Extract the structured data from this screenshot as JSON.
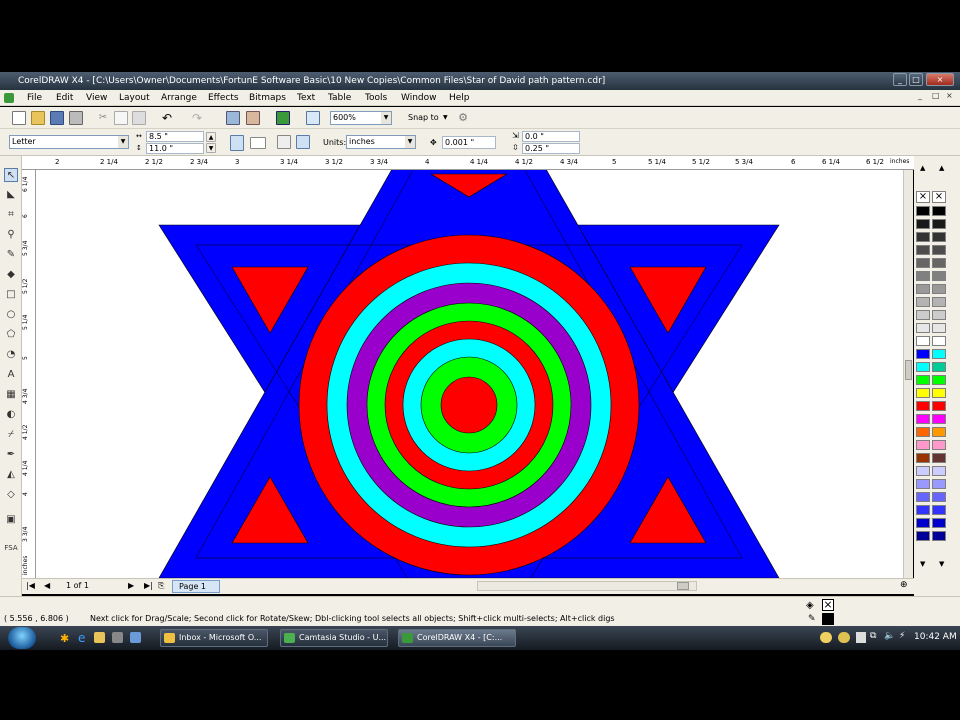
{
  "window": {
    "title": "CorelDRAW X4 - [C:\\Users\\Owner\\Documents\\FortunE Software Basic\\10 New Copies\\Common Files\\Star of David path pattern.cdr]",
    "min": "_",
    "max": "□",
    "close": "×"
  },
  "menu": [
    "File",
    "Edit",
    "View",
    "Layout",
    "Arrange",
    "Effects",
    "Bitmaps",
    "Text",
    "Table",
    "Tools",
    "Window",
    "Help"
  ],
  "toolbar": {
    "zoom": "600%",
    "snap_to": "Snap to"
  },
  "property_bar": {
    "paper": "Letter",
    "width": "8.5 \"",
    "height": "11.0 \"",
    "units_label": "Units:",
    "units": "inches",
    "nudge": "0.001 \"",
    "dup_x": "0.0 \"",
    "dup_y": "0.25 \""
  },
  "ruler_h": {
    "unit": "inches",
    "labels": [
      "2",
      "2 1/4",
      "2 1/2",
      "2 3/4",
      "3",
      "3 1/4",
      "3 1/2",
      "3 3/4",
      "4",
      "4 1/4",
      "4 1/2",
      "4 3/4",
      "5",
      "5 1/4",
      "5 1/2",
      "5 3/4",
      "6",
      "6 1/4",
      "6 1/2"
    ]
  },
  "ruler_v": {
    "unit": "inches",
    "labels": [
      "6 1/4",
      "6",
      "5 3/4",
      "5 1/2",
      "5 1/4",
      "5",
      "4 3/4",
      "4 1/2",
      "4 1/4",
      "4",
      "3 3/4"
    ]
  },
  "page_nav": {
    "count": "1 of 1",
    "tab": "Page 1"
  },
  "status": {
    "coords": "( 5.556 , 6.806 )",
    "hint": "Next click for Drag/Scale; Second click for Rotate/Skew; Dbl-clicking tool selects all objects; Shift+click multi-selects; Alt+click digs"
  },
  "drawing": {
    "star_color": "#0000ff",
    "triangle_color": "#ff0000",
    "rings": [
      "#ff0000",
      "#00ffff",
      "#9900cc",
      "#00ff00",
      "#ff0000",
      "#00ffff",
      "#00ff00",
      "#ff0000"
    ]
  },
  "palette": {
    "left": [
      "#000000",
      "#1a1a1a",
      "#333333",
      "#4d4d4d",
      "#666666",
      "#808080",
      "#999999",
      "#b3b3b3",
      "#cccccc",
      "#e6e6e6",
      "#ffffff",
      "#0000ff",
      "#00ffff",
      "#00ff00",
      "#ffff00",
      "#ff0000",
      "#ff00ff",
      "#ff6600",
      "#ff99cc",
      "#993300",
      "#ccccff",
      "#9999ff",
      "#6666ff",
      "#3333ff",
      "#0000cc",
      "#000099"
    ],
    "right": [
      "#000000",
      "#1a1a1a",
      "#333333",
      "#4d4d4d",
      "#666666",
      "#808080",
      "#999999",
      "#b3b3b3",
      "#cccccc",
      "#e6e6e6",
      "#ffffff",
      "#00ffff",
      "#00cc99",
      "#00ff00",
      "#ffff00",
      "#ff0000",
      "#ff00ff",
      "#ff9900",
      "#ff99cc",
      "#663333",
      "#ccccff",
      "#9999ff",
      "#6666ff",
      "#3333ff",
      "#0000cc",
      "#000099"
    ]
  },
  "taskbar": {
    "tasks": [
      "Inbox - Microsoft O...",
      "Camtasia Studio - U...",
      "CorelDRAW X4 - [C:..."
    ],
    "clock": "10:42 AM"
  }
}
